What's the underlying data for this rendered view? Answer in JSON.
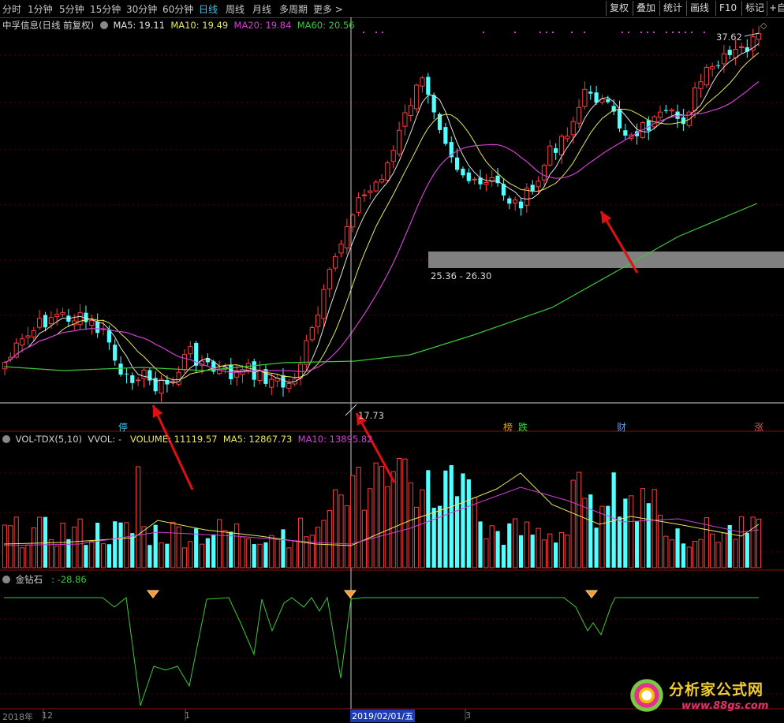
{
  "toolbar": {
    "periods": [
      "分时",
      "1分钟",
      "5分钟",
      "15分钟",
      "30分钟",
      "60分钟",
      "日线",
      "周线",
      "月线",
      "多周期",
      "更多"
    ],
    "active": "日线",
    "right_buttons": [
      "复权",
      "叠加",
      "统计",
      "画线",
      "F10",
      "标记",
      "+自"
    ]
  },
  "price_panel": {
    "stock_name": "中孚信息(日线 前复权)",
    "ma5": "MA5: 19.11",
    "ma10": "MA10: 19.49",
    "ma20": "MA20: 19.84",
    "ma60": "MA60: 20.56",
    "high_label": "37.62",
    "low_label": "17.73",
    "zone_label": "25.36 - 26.30",
    "markers": [
      {
        "text": "停",
        "color": "#39c6f0"
      },
      {
        "text": "榜",
        "color": "#e0a000"
      },
      {
        "text": "跌",
        "color": "#2ee02e"
      },
      {
        "text": "财",
        "color": "#5aa0ff"
      },
      {
        "text": "涨",
        "color": "#ff4040"
      }
    ]
  },
  "volume_panel": {
    "title": "VOL-TDX(5,10)",
    "vvol": "VVOL: -",
    "volume": "VOLUME: 11119.57",
    "ma5": "MA5: 12867.73",
    "ma10": "MA10: 13895.82"
  },
  "indicator_panel": {
    "title": "金钻石",
    "value": ": -28.86"
  },
  "time_axis": {
    "labels": [
      "2018年",
      "12",
      "1",
      "2019/02/01/五",
      "3"
    ]
  },
  "watermark": {
    "text": "分析家公式网",
    "url": "www.88gs.com"
  },
  "colors": {
    "up": "#ff3c3c",
    "down": "#54ffff",
    "ma5": "#e0e0e0",
    "ma10": "#e8e85a",
    "ma20": "#d040d0",
    "ma60": "#3cc83c",
    "indicator": "#3cc83c"
  }
}
